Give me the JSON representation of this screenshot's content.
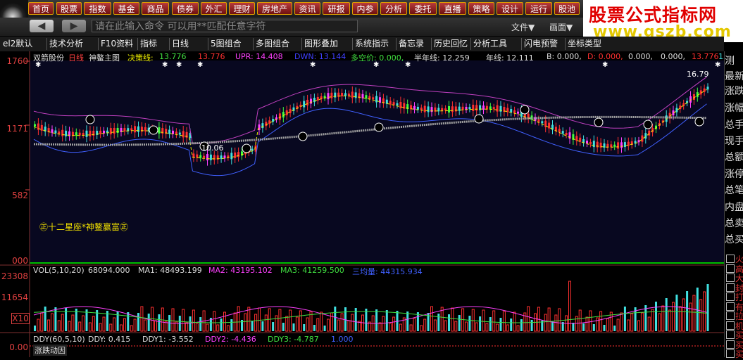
{
  "nav": [
    "首页",
    "股票",
    "指数",
    "基金",
    "商品",
    "债券",
    "外汇",
    "理财",
    "房地产",
    "资讯",
    "研报",
    "内参",
    "分析",
    "委托",
    "直播",
    "策略",
    "设计",
    "运行",
    "股池"
  ],
  "banner": {
    "title": "股票公式指标网",
    "url": "www.gszb.com"
  },
  "command": {
    "placeholder": "请在此输入命令  可以用**匹配任意字符",
    "file": "文件▼",
    "view": "画面▼"
  },
  "toolbar": [
    "el2默认",
    "技术分析",
    "F10资料",
    "指标",
    "日线",
    "5图组合",
    "多图组合",
    "图形叠加",
    "系统指示",
    "备忘录",
    "历史回忆",
    "分析工具",
    "闪电预警",
    "坐标类型"
  ],
  "price_axis": [
    "1760",
    "1171",
    "582",
    "000"
  ],
  "vol_axis": [
    "23308",
    "11654",
    "X10"
  ],
  "ddy_axis": "0.00",
  "header": {
    "stock": "双箭股份",
    "period": "日线",
    "main": "神鳌主图",
    "jc_label": "决策线:",
    "jc_val": "13.776",
    "v2": "13.776",
    "upr": "UPR: 14.408",
    "dwn": "DWN: 13.144",
    "dk": "多空价: 0.000,",
    "half": "半年线: 12.259",
    "year": "年线: 12.111",
    "b": "B: 0.000,",
    "d": "D: 0.000,",
    "z1": "0.000,",
    "z2": "0.000,",
    "v3": "13.776",
    "v4": "13.776"
  },
  "annotations": {
    "high": "16.79",
    "low": "10.06",
    "watermark": "㊣十二星座*神鳌赢富㊣"
  },
  "vol_header": {
    "name": "VOL(5,10,20)",
    "v": "68094.000",
    "ma1": "MA1: 48493.199",
    "ma2": "MA2: 43195.102",
    "ma3": "MA3: 41259.500",
    "sj": "三均量: 44315.934"
  },
  "ddy_header": {
    "name": "DDY(60,5,10)",
    "ddy": "DDY: 0.415",
    "ddy1": "DDY1: -3.552",
    "ddy2": "DDY2: -4.436",
    "ddy3": "DDY3: -4.787",
    "one": "1.000",
    "tab": "涨跌动因"
  },
  "right_panel": {
    "labels": [
      "测",
      "最新",
      "涨跌",
      "涨幅",
      "总手",
      "现手",
      "总额",
      "涨停",
      "总笔",
      "内盘",
      "总卖",
      "总买"
    ],
    "checks": [
      "火",
      "高",
      "大",
      "封",
      "打",
      "有",
      "拉",
      "机",
      "买",
      "买",
      "买"
    ]
  },
  "colors": {
    "up": "#ff3030",
    "down": "#40e0e0",
    "pink": "#ff40ff",
    "bg_main": "#080820"
  }
}
